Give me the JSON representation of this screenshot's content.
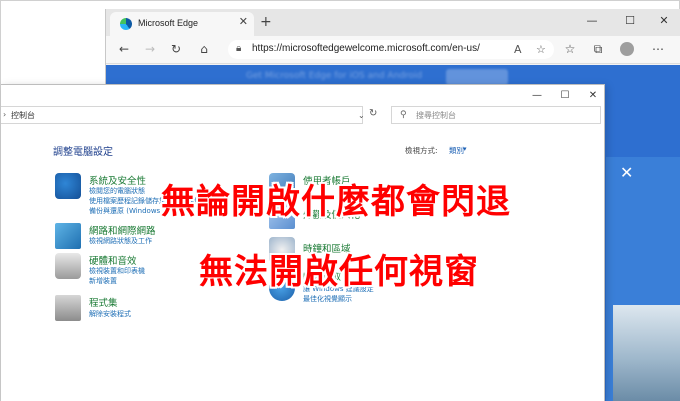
{
  "edge": {
    "tab_title": "Microsoft Edge",
    "tab_close": "✕",
    "new_tab": "+",
    "url": "https://microsoftedgewelcome.microsoft.com/en-us/",
    "banner_text": "Get Microsoft Edge for iOS and Android",
    "win_min": "—",
    "win_max": "☐",
    "win_close": "✕",
    "panel_close": "✕"
  },
  "control_panel": {
    "path_arrow": "›",
    "path": "控制台",
    "dropdown_caret": "⌄",
    "refresh": "↻",
    "search_placeholder": "搜尋控制台",
    "heading": "調整電腦設定",
    "view_by_label": "檢視方式:",
    "view_by_value": "類別",
    "win_min": "—",
    "win_max": "☐",
    "win_close": "✕",
    "categories": [
      {
        "title": "系統及安全性",
        "links": [
          "檢閱您的電腦狀態",
          "使用檔案歷程記錄儲存您檔案的備份複本",
          "備份與還原 (Windows 7)"
        ]
      },
      {
        "title": "網路和網際網路",
        "links": [
          "檢視網路狀態及工作"
        ]
      },
      {
        "title": "硬體和音效",
        "links": [
          "檢視裝置和印表機",
          "新增裝置"
        ]
      },
      {
        "title": "程式集",
        "links": [
          "解除安裝程式"
        ]
      },
      {
        "title": "使用者帳戶",
        "links": []
      },
      {
        "title": "外觀及個人化",
        "links": []
      },
      {
        "title": "時鐘和區域",
        "links": []
      },
      {
        "title": "輕鬆存取",
        "links": [
          "讓 Windows 建議設定",
          "最佳化視覺顯示"
        ]
      }
    ]
  },
  "overlay": {
    "line1": "無論開啟什麼都會閃退",
    "line2": "無法開啟任何視窗"
  }
}
